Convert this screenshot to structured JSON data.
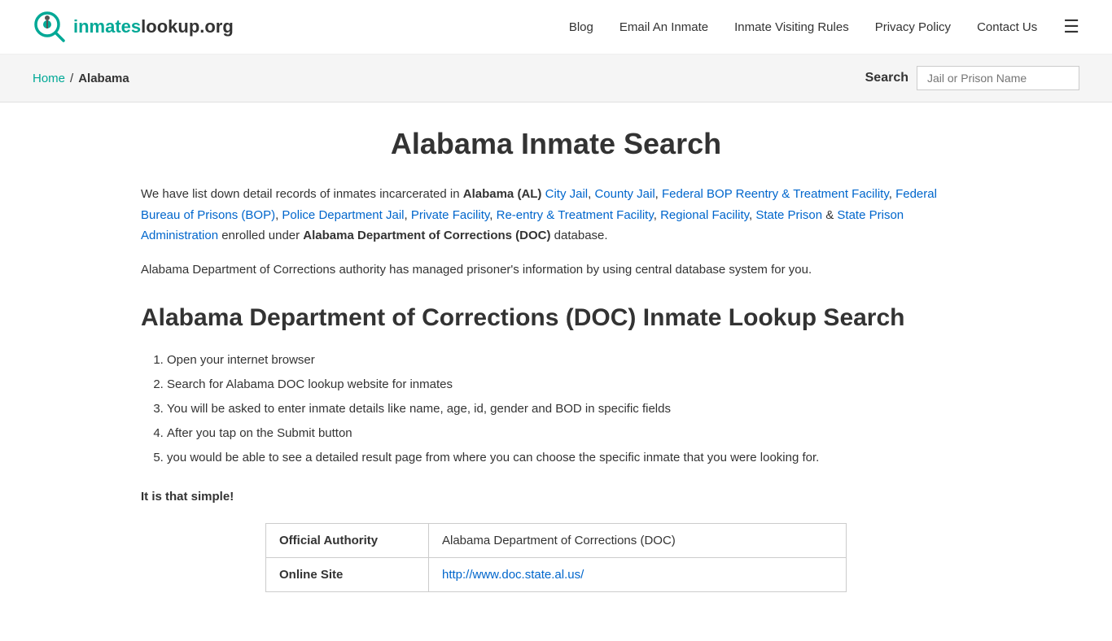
{
  "header": {
    "logo_text_part1": "inmates",
    "logo_text_part2": "lookup.org",
    "nav": {
      "blog": "Blog",
      "email_inmate": "Email An Inmate",
      "visiting_rules": "Inmate Visiting Rules",
      "privacy_policy": "Privacy Policy",
      "contact_us": "Contact Us"
    }
  },
  "breadcrumb": {
    "home_label": "Home",
    "home_href": "#",
    "separator": "/",
    "current": "Alabama"
  },
  "search": {
    "label": "Search",
    "placeholder": "Jail or Prison Name"
  },
  "main": {
    "page_title": "Alabama Inmate Search",
    "intro_paragraph": "We have list down detail records of inmates incarcerated in ",
    "state_bold": "Alabama (AL)",
    "links": [
      {
        "text": "City Jail",
        "href": "#"
      },
      {
        "text": "County Jail",
        "href": "#"
      },
      {
        "text": "Federal BOP Reentry & Treatment Facility",
        "href": "#"
      },
      {
        "text": "Federal Bureau of Prisons (BOP)",
        "href": "#"
      },
      {
        "text": "Police Department Jail",
        "href": "#"
      },
      {
        "text": "Private Facility",
        "href": "#"
      },
      {
        "text": "Re-entry & Treatment Facility",
        "href": "#"
      },
      {
        "text": "Regional Facility",
        "href": "#"
      },
      {
        "text": "State Prison",
        "href": "#"
      },
      {
        "text": "State Prison Administration",
        "href": "#"
      }
    ],
    "intro_mid": " enrolled under ",
    "doc_bold": "Alabama Department of Corrections (DOC)",
    "intro_end": " database.",
    "desc_text": "Alabama Department of Corrections authority has managed prisoner's information by using central database system for you.",
    "section_title": "Alabama Department of Corrections (DOC) Inmate Lookup Search",
    "steps": [
      "Open your internet browser",
      "Search for Alabama DOC lookup website for inmates",
      "You will be asked to enter inmate details like name, age, id, gender and BOD in specific fields",
      "After you tap on the Submit button",
      "you would be able to see a detailed result page from where you can choose the specific inmate that you were looking for."
    ],
    "simple_label": "It is that simple!",
    "table": {
      "row1_label": "Official Authority",
      "row1_value": "Alabama Department of Corrections (DOC)",
      "row2_label": "Online Site",
      "row2_link_text": "http://www.doc.state.al.us/",
      "row2_link_href": "http://www.doc.state.al.us/"
    }
  }
}
